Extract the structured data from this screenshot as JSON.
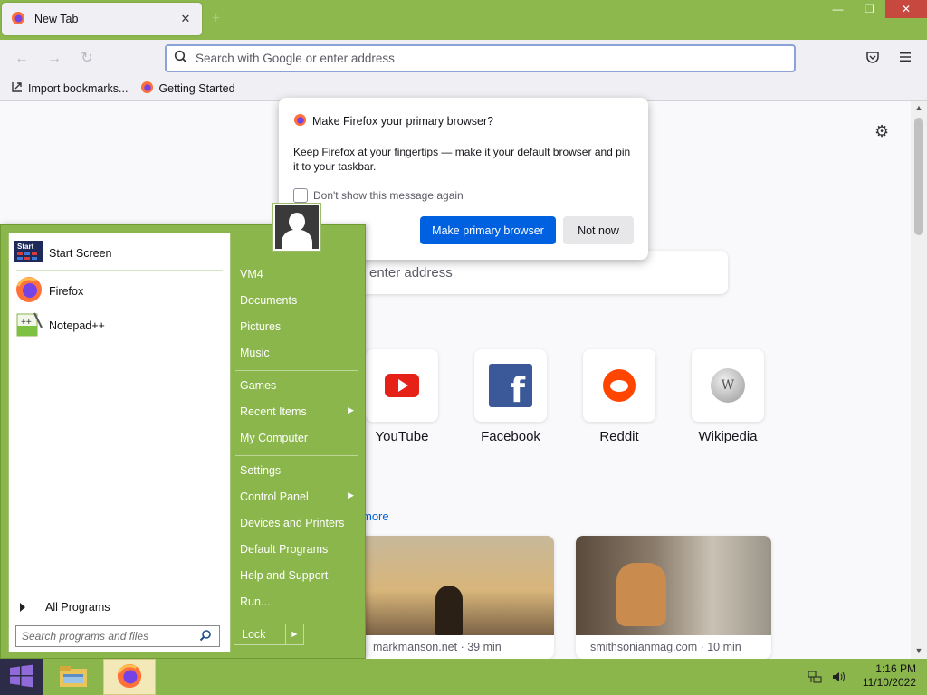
{
  "browser": {
    "tab": {
      "label": "New Tab",
      "close": "✕",
      "new_tab": "+"
    },
    "window_controls": {
      "minimize": "—",
      "maximize": "❐",
      "close": "✕"
    },
    "nav": {
      "back": "←",
      "forward": "→",
      "reload": "↻"
    },
    "urlbar": {
      "placeholder": "Search with Google or enter address"
    },
    "bookmarks": [
      {
        "label": "Import bookmarks...",
        "icon": "import-icon"
      },
      {
        "label": "Getting Started",
        "icon": "firefox-icon"
      }
    ]
  },
  "newtab": {
    "search_placeholder": "enter address",
    "top_sites": [
      {
        "label": "YouTube",
        "icon": "youtube-icon"
      },
      {
        "label": "Facebook",
        "icon": "facebook-icon"
      },
      {
        "label": "Reddit",
        "icon": "reddit-icon"
      },
      {
        "label": "Wikipedia",
        "icon": "wikipedia-icon"
      }
    ],
    "more_link": "more",
    "stories": [
      {
        "source": "markmanson.net · 39 min"
      },
      {
        "source": "smithsonianmag.com · 10 min"
      }
    ]
  },
  "popup": {
    "title": "Make Firefox your primary browser?",
    "body": "Keep Firefox at your fingertips — make it your default browser and pin it to your taskbar.",
    "checkbox_label": "Don't show this message again",
    "primary_button": "Make primary browser",
    "secondary_button": "Not now"
  },
  "start_menu": {
    "pinned": [
      {
        "label": "Start Screen",
        "icon": "start-screen-icon"
      },
      {
        "label": "Firefox",
        "icon": "firefox-icon"
      },
      {
        "label": "Notepad++",
        "icon": "notepadpp-icon"
      }
    ],
    "start_screen_badge": "Start",
    "all_programs": "All Programs",
    "search_placeholder": "Search programs and files",
    "right_items": [
      {
        "label": "VM4",
        "has_arrow": false
      },
      {
        "label": "Documents",
        "has_arrow": false
      },
      {
        "label": "Pictures",
        "has_arrow": false
      },
      {
        "label": "Music",
        "has_arrow": false
      },
      {
        "label": "Games",
        "has_arrow": false
      },
      {
        "label": "Recent Items",
        "has_arrow": true
      },
      {
        "label": "My Computer",
        "has_arrow": false
      },
      {
        "label": "Settings",
        "has_arrow": false
      },
      {
        "label": "Control Panel",
        "has_arrow": true
      },
      {
        "label": "Devices and Printers",
        "has_arrow": false
      },
      {
        "label": "Default Programs",
        "has_arrow": false
      },
      {
        "label": "Help and Support",
        "has_arrow": false
      },
      {
        "label": "Run...",
        "has_arrow": false
      }
    ],
    "lock_label": "Lock",
    "arrow": "▶"
  },
  "taskbar": {
    "apps": [
      {
        "name": "file-explorer",
        "icon": "folder-icon"
      },
      {
        "name": "firefox",
        "icon": "firefox-icon",
        "active": true
      }
    ],
    "clock": {
      "time": "1:16 PM",
      "date": "11/10/2022"
    }
  },
  "colors": {
    "accent_green": "#8ab64c",
    "firefox_blue": "#0061e0",
    "start_button": "#2c2c48"
  }
}
